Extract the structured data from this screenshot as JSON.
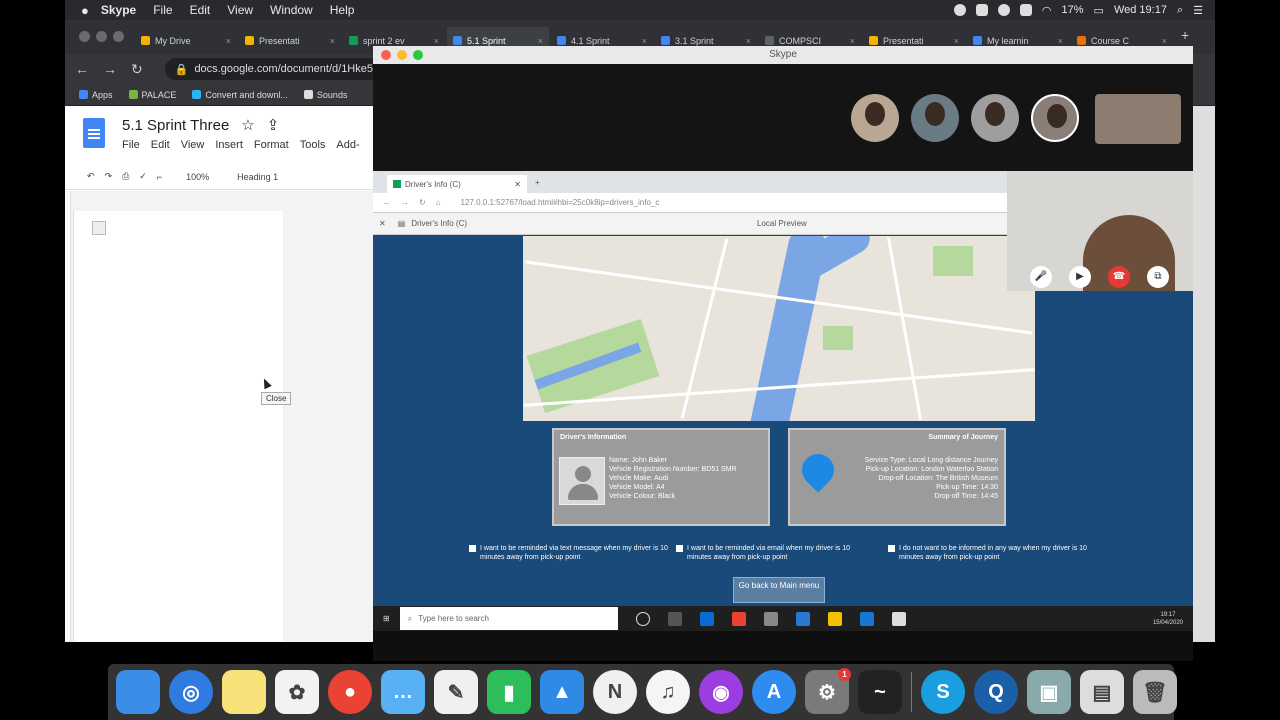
{
  "menubar": {
    "app": "Skype",
    "items": [
      "File",
      "Edit",
      "View",
      "Window",
      "Help"
    ],
    "battery": "17%",
    "clock": "Wed 19:17"
  },
  "chrome": {
    "tabs": [
      {
        "label": "My Drive",
        "color": "#f4b400"
      },
      {
        "label": "Presentati",
        "color": "#f4b400"
      },
      {
        "label": "sprint 2 ev",
        "color": "#0f9d58"
      },
      {
        "label": "5.1 Sprint",
        "color": "#4285f4"
      },
      {
        "label": "4.1 Sprint",
        "color": "#4285f4"
      },
      {
        "label": "3.1 Sprint",
        "color": "#4285f4"
      },
      {
        "label": "COMPSCI",
        "color": "#5f6368"
      },
      {
        "label": "Presentati",
        "color": "#f4b400"
      },
      {
        "label": "My learnin",
        "color": "#4285f4"
      },
      {
        "label": "Course C",
        "color": "#e8710a"
      }
    ],
    "url": "docs.google.com/document/d/1Hke5",
    "bookmarks": [
      {
        "label": "Apps",
        "color": "#4285f4"
      },
      {
        "label": "PALACE",
        "color": "#7cb342"
      },
      {
        "label": "Convert and downl...",
        "color": "#29b6f6"
      },
      {
        "label": "Sounds",
        "color": "#ddd"
      }
    ]
  },
  "docs": {
    "title": "5.1 Sprint Three",
    "menu": [
      "File",
      "Edit",
      "View",
      "Insert",
      "Format",
      "Tools",
      "Add-"
    ],
    "zoom": "100%",
    "style": "Heading 1",
    "tooltip": "Close"
  },
  "skype": {
    "window_title": "Skype",
    "inner_tab": "Driver's Info (C)",
    "inner_url": "127.0.0.1:52767/load.html#hbi=25c0k8ip=drivers_info_c",
    "preview_file": "Driver's Info (C)",
    "preview_label": "Local Preview",
    "driver_card": {
      "title": "Driver's Information",
      "lines": [
        "Name: John Baker",
        "Vehicle Registration Number: BD51 SMR",
        "Vehicle Make: Audi",
        "Vehicle Model: A4",
        "Vehicle Colour: Black"
      ]
    },
    "journey_card": {
      "title": "Summary of Journey",
      "lines": [
        "Service Type: Local Long distance Journey",
        "Pick-up Location: London Waterloo Station",
        "Drop-off Location: The British Museum",
        "Pick-up Time: 14:30",
        "Drop-off Time: 14:45"
      ]
    },
    "options": [
      "I want to be reminded via text message when my driver is 10 minutes away from pick-up point",
      "I want to be reminded via email when my driver is 10 minutes away from pick-up point",
      "I do not want to be informed in any way when my driver is 10 minutes away from pick-up point"
    ],
    "back_button": "Go back to Main menu",
    "win_search": "Type here to search",
    "win_clock": "19:17",
    "win_date": "15/04/2020"
  },
  "dock": {
    "apps": [
      {
        "name": "finder",
        "color": "#3b8ee8",
        "glyph": ""
      },
      {
        "name": "safari",
        "color": "#2f7be0",
        "glyph": "◎"
      },
      {
        "name": "notes",
        "color": "#f7e27a",
        "glyph": ""
      },
      {
        "name": "photos",
        "color": "#f2f2f2",
        "glyph": "✿"
      },
      {
        "name": "chrome",
        "color": "#ea4335",
        "glyph": "●"
      },
      {
        "name": "messages",
        "color": "#58b0f5",
        "glyph": "…"
      },
      {
        "name": "textedit",
        "color": "#f0f0f0",
        "glyph": "✎"
      },
      {
        "name": "numbers",
        "color": "#2dbd5a",
        "glyph": "▮"
      },
      {
        "name": "keynote",
        "color": "#2f8ae5",
        "glyph": "▲"
      },
      {
        "name": "news",
        "color": "#f0f0f0",
        "glyph": "N"
      },
      {
        "name": "music",
        "color": "#f5f5f5",
        "glyph": "♫"
      },
      {
        "name": "podcasts",
        "color": "#9b3de0",
        "glyph": "◉"
      },
      {
        "name": "app-store",
        "color": "#2e8cf0",
        "glyph": "A"
      },
      {
        "name": "system-preferences",
        "color": "#7a7a7a",
        "glyph": "⚙",
        "badge": "1"
      },
      {
        "name": "activity-monitor",
        "color": "#222",
        "glyph": "~"
      },
      {
        "name": "skype",
        "color": "#1a9ee0",
        "glyph": "S"
      },
      {
        "name": "quicktime",
        "color": "#1b5fa8",
        "glyph": "Q"
      },
      {
        "name": "preview",
        "color": "#8aa",
        "glyph": "▣"
      },
      {
        "name": "folder",
        "color": "#ddd",
        "glyph": "▤"
      },
      {
        "name": "trash",
        "color": "#bbb",
        "glyph": "🗑"
      }
    ]
  }
}
